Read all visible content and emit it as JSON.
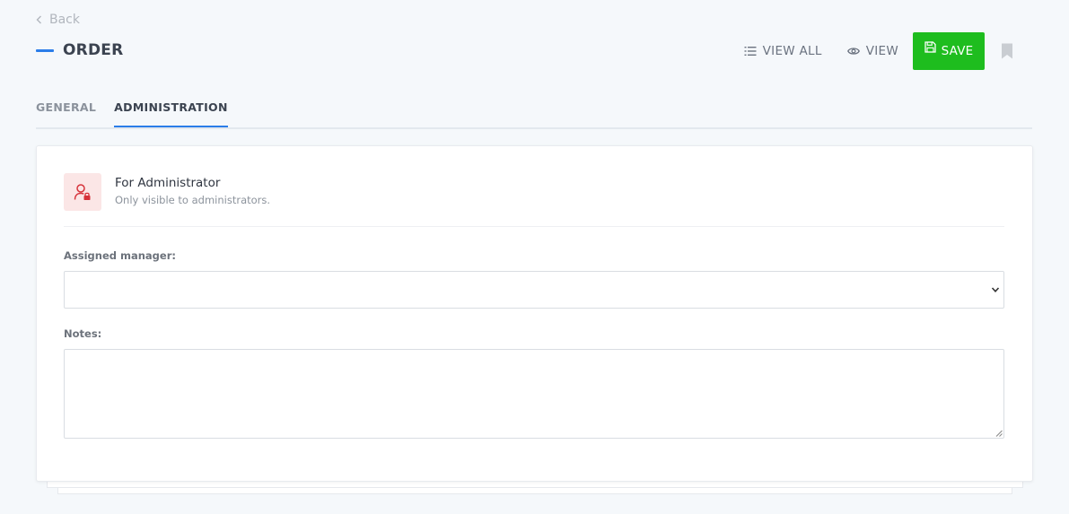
{
  "nav": {
    "back_label": "Back"
  },
  "header": {
    "title": "ORDER"
  },
  "toolbar": {
    "view_all_label": "VIEW ALL",
    "view_label": "VIEW",
    "save_label": "SAVE"
  },
  "tabs": [
    {
      "label": "GENERAL",
      "active": false
    },
    {
      "label": "ADMINISTRATION",
      "active": true
    }
  ],
  "section": {
    "title": "For Administrator",
    "subtitle": "Only visible to administrators.",
    "icon": "admin-lock-icon"
  },
  "fields": {
    "manager_label": "Assigned manager:",
    "manager_value": "",
    "notes_label": "Notes:",
    "notes_value": ""
  },
  "colors": {
    "accent": "#2b7de9",
    "save": "#1ebd1e",
    "admin_icon_bg": "#fbe6e6",
    "admin_icon": "#d6323a"
  }
}
